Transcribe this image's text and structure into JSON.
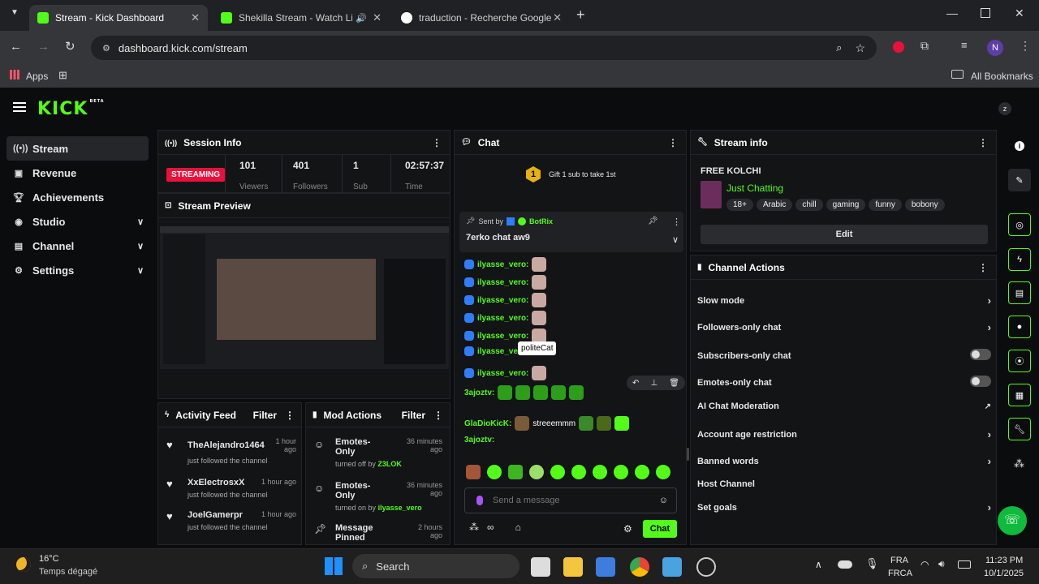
{
  "browser": {
    "tabs": [
      {
        "title": "Stream - Kick Dashboard"
      },
      {
        "title": "Shekilla Stream - Watch Live"
      },
      {
        "title": "traduction - Recherche Google"
      }
    ],
    "url": "dashboard.kick.com/stream",
    "bookmarks": {
      "apps": "Apps",
      "all": "All Bookmarks"
    },
    "profile_initial": "N"
  },
  "kick": {
    "logo": "KICK",
    "beta": "BETA",
    "sidebar": [
      {
        "label": "Stream",
        "icon": "stream-icon"
      },
      {
        "label": "Revenue",
        "icon": "revenue-icon"
      },
      {
        "label": "Achievements",
        "icon": "trophy-icon"
      },
      {
        "label": "Studio",
        "icon": "studio-icon"
      },
      {
        "label": "Channel",
        "icon": "channel-icon"
      },
      {
        "label": "Settings",
        "icon": "gear-icon"
      }
    ],
    "session": {
      "title": "Session Info",
      "status": "STREAMING",
      "stats": [
        {
          "value": "101",
          "label": "Viewers"
        },
        {
          "value": "401",
          "label": "Followers"
        },
        {
          "value": "1",
          "label": "Sub"
        },
        {
          "value": "02:57:37",
          "label": "Time"
        }
      ]
    },
    "preview": {
      "title": "Stream Preview"
    },
    "activity": {
      "title": "Activity Feed",
      "filter": "Filter",
      "items": [
        {
          "user": "TheAlejandro1464",
          "time": "1 hour ago",
          "action": "just followed the channel"
        },
        {
          "user": "XxElectrosxX",
          "time": "1 hour ago",
          "action": "just followed the channel"
        },
        {
          "user": "JoelGamerpr",
          "time": "1 hour ago",
          "action": "just followed the channel"
        }
      ]
    },
    "mod": {
      "title": "Mod Actions",
      "filter": "Filter",
      "items": [
        {
          "label": "Emotes-Only",
          "time": "36 minutes ago",
          "detail": "turned off by",
          "by": "Z3LOK"
        },
        {
          "label": "Emotes-Only",
          "time": "36 minutes ago",
          "detail": "turned on by",
          "by": "ilyasse_vero"
        },
        {
          "label": "Message Pinned",
          "time": "2 hours ago",
          "detail": "",
          "by": ""
        }
      ]
    },
    "chat": {
      "title": "Chat",
      "gift": "Gift 1 sub to take 1st",
      "gift_count": "1",
      "pinned": {
        "sent_by": "Sent by",
        "bot": "BotRix",
        "text": "7erko chat aw9"
      },
      "users": {
        "ilyasse": "ilyasse_vero:",
        "ilyasse_cut": "ilyasse_ve",
        "aja": "3ajoztv:",
        "gla": "GlaDioKicK:"
      },
      "gla_text": "streeemmm",
      "tooltip": "politeCat",
      "input_placeholder": "Send a message",
      "send": "Chat"
    },
    "streaminfo": {
      "title": "Stream info",
      "stream_title": "FREE KOLCHI",
      "category": "Just Chatting",
      "tags": [
        "18+",
        "Arabic",
        "chill",
        "gaming",
        "funny",
        "bobony"
      ],
      "edit": "Edit"
    },
    "channel_actions": {
      "title": "Channel Actions",
      "rows": [
        {
          "label": "Slow mode",
          "control": "chevron"
        },
        {
          "label": "Followers-only chat",
          "control": "chevron"
        },
        {
          "label": "Subscribers-only chat",
          "control": "toggle"
        },
        {
          "label": "Emotes-only chat",
          "control": "toggle"
        },
        {
          "label": "AI Chat Moderation",
          "control": "external"
        },
        {
          "label": "Account age restriction",
          "control": "chevron"
        },
        {
          "label": "Banned words",
          "control": "chevron"
        },
        {
          "label": "Host Channel",
          "control": "none"
        },
        {
          "label": "Set goals",
          "control": "chevron"
        }
      ]
    }
  },
  "taskbar": {
    "weather_temp": "16°C",
    "weather_desc": "Temps dégagé",
    "search": "Search",
    "lang1": "FRA",
    "lang2": "FRCA",
    "time": "11:23 PM",
    "date": "10/1/2025"
  },
  "colors": {
    "accent": "#53fc18",
    "live": "#e9113c",
    "bg": "#0b0c0d"
  }
}
